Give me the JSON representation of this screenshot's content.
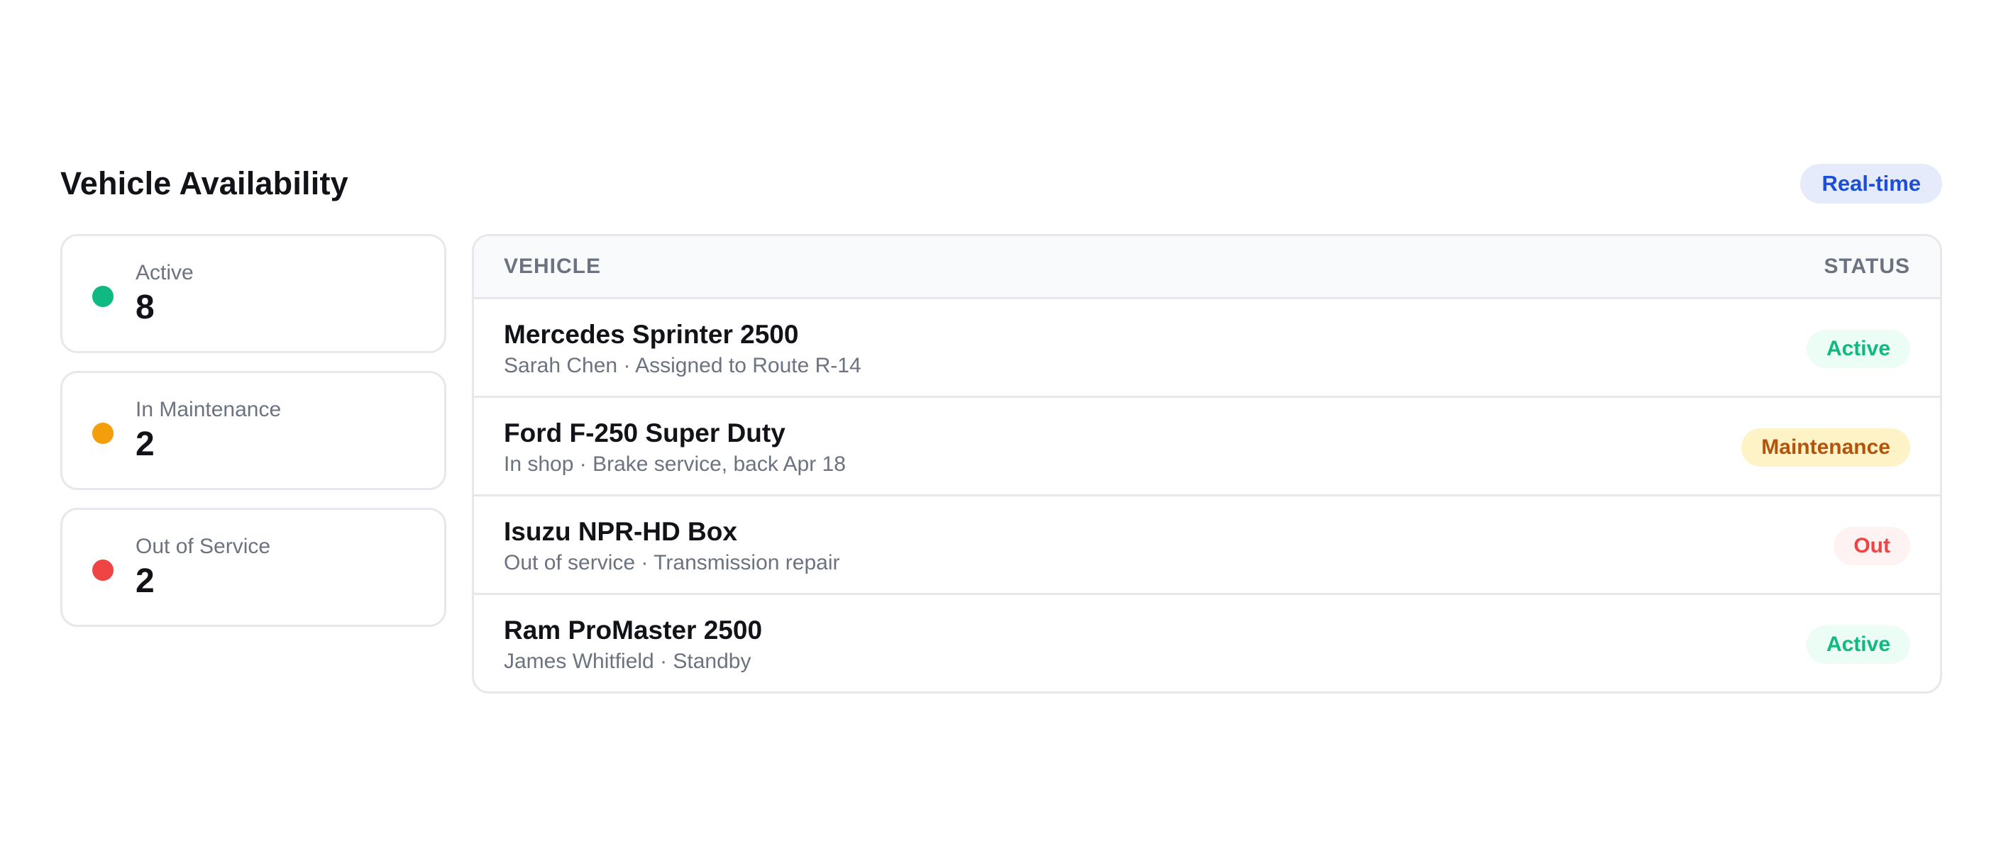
{
  "header": {
    "title": "Vehicle Availability",
    "badge": "Real-time"
  },
  "summary": [
    {
      "label": "Active",
      "value": "8",
      "color": "#10b981"
    },
    {
      "label": "In Maintenance",
      "value": "2",
      "color": "#f59e0b"
    },
    {
      "label": "Out of Service",
      "value": "2",
      "color": "#ef4444"
    }
  ],
  "table": {
    "columns": {
      "vehicle": "VEHICLE",
      "status": "STATUS"
    },
    "rows": [
      {
        "name": "Mercedes Sprinter 2500",
        "detail": "Sarah Chen · Assigned to Route R-14",
        "status": "Active",
        "status_text_color": "#10b981",
        "status_bg_color": "#ecfdf5"
      },
      {
        "name": "Ford F-250 Super Duty",
        "detail": "In shop · Brake service, back Apr 18",
        "status": "Maintenance",
        "status_text_color": "#b45309",
        "status_bg_color": "#fef3c7"
      },
      {
        "name": "Isuzu NPR-HD Box",
        "detail": "Out of service · Transmission repair",
        "status": "Out",
        "status_text_color": "#ef4444",
        "status_bg_color": "#fef2f2"
      },
      {
        "name": "Ram ProMaster 2500",
        "detail": "James Whitfield · Standby",
        "status": "Active",
        "status_text_color": "#10b981",
        "status_bg_color": "#ecfdf5"
      }
    ]
  }
}
